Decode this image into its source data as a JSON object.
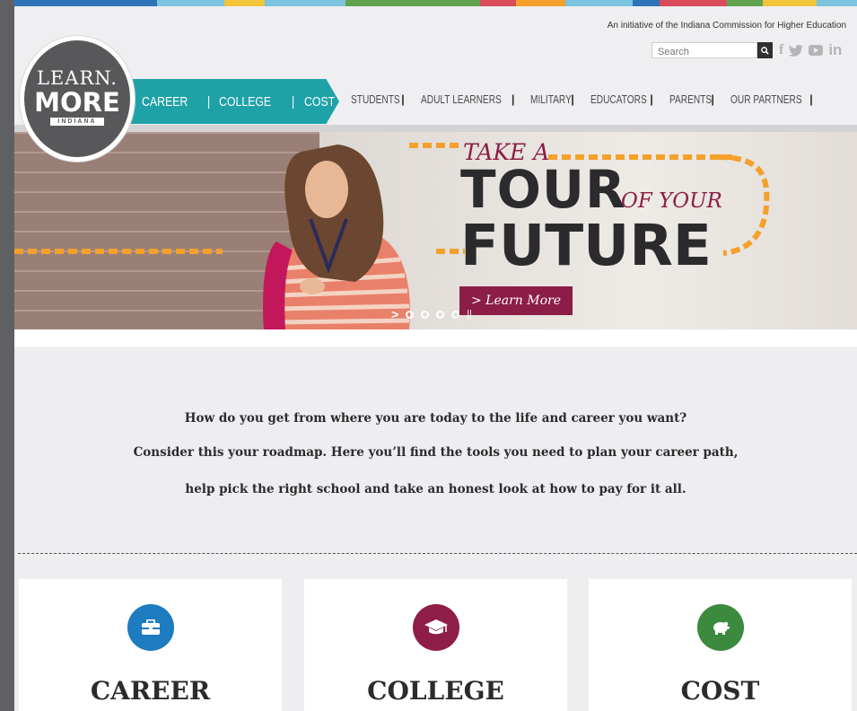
{
  "colors": {
    "teal": "#1fa2a7",
    "maroon": "#8b1d47",
    "orange": "#f4a02a",
    "career_blue": "#1d7bc0",
    "college_maroon": "#8e1e48",
    "cost_green": "#3b8a3e",
    "top_stripes": [
      "#2e73b8",
      "#2e73b8",
      "#7bc4e0",
      "#f2c53a",
      "#7bc4e0",
      "#5fa44d",
      "#5fa44d",
      "#d94b5a",
      "#f4a02a",
      "#7bc4e0",
      "#2e73b8",
      "#d94b5a",
      "#5fa44d",
      "#f2c53a",
      "#7bc4e0"
    ]
  },
  "header": {
    "initiative": "An initiative of the Indiana Commission for Higher Education",
    "search_placeholder": "Search",
    "social": [
      {
        "name": "facebook-icon",
        "glyph": "f"
      },
      {
        "name": "twitter-icon",
        "glyph": "🐦"
      },
      {
        "name": "youtube-icon",
        "glyph": "▶"
      },
      {
        "name": "linkedin-icon",
        "glyph": "in"
      }
    ]
  },
  "logo": {
    "line1": "LEARN.",
    "line2": "MORE",
    "line3": "INDIANA"
  },
  "primary_nav": [
    "CAREER",
    "COLLEGE",
    "COST"
  ],
  "audience_nav": [
    "STUDENTS",
    "ADULT LEARNERS",
    "MILITARY",
    "EDUCATORS",
    "PARENTS",
    "OUR PARTNERS"
  ],
  "hero": {
    "take_a": "TAKE A",
    "tour": "TOUR",
    "of_your": "OF YOUR",
    "future": "FUTURE",
    "button": "> Learn More",
    "slide_count": 4
  },
  "intro": {
    "line1": "How do you get from where you are today to the life and career you want?",
    "line2": "Consider this your roadmap. Here you’ll find the tools you need to plan your career path,",
    "line3": "help pick the right school and take an honest look at how to pay for it all."
  },
  "cards": [
    {
      "title": "CAREER",
      "icon": "briefcase-icon"
    },
    {
      "title": "COLLEGE",
      "icon": "graduation-cap-icon"
    },
    {
      "title": "COST",
      "icon": "piggy-bank-icon"
    }
  ]
}
